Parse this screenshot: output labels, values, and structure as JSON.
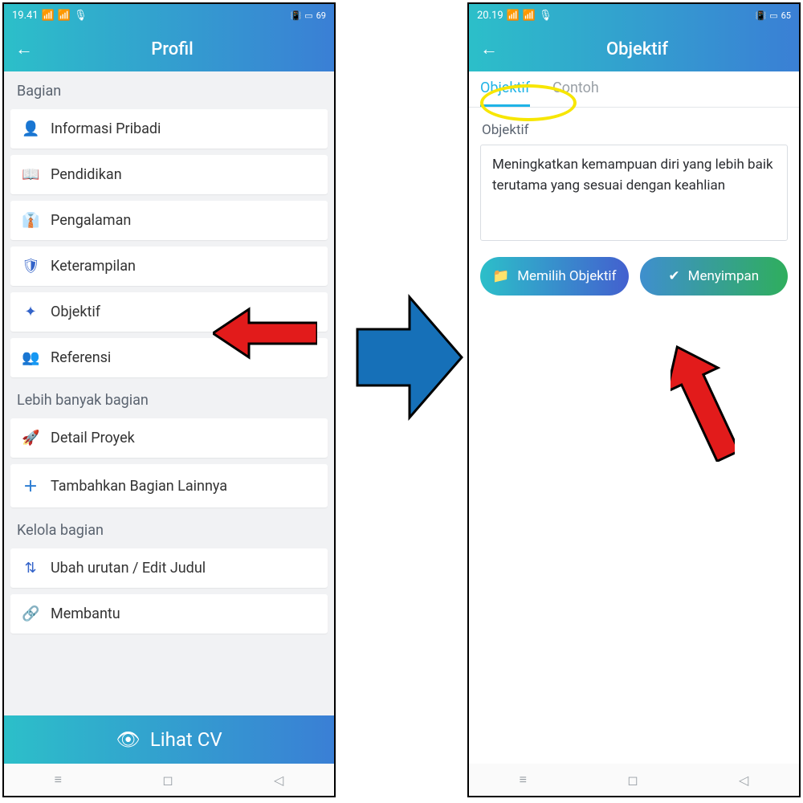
{
  "left": {
    "status": {
      "time": "19.41",
      "battery": "69"
    },
    "header": {
      "title": "Profil"
    },
    "sections": {
      "bagian_label": "Bagian",
      "items": [
        {
          "icon": "user-icon",
          "glyph": "👤",
          "label": "Informasi Pribadi"
        },
        {
          "icon": "education-icon",
          "glyph": "📖",
          "label": "Pendidikan"
        },
        {
          "icon": "experience-icon",
          "glyph": "👔",
          "label": "Pengalaman"
        },
        {
          "icon": "skills-icon",
          "glyph": "🛡",
          "label": "Keterampilan"
        },
        {
          "icon": "objective-icon",
          "glyph": "✦",
          "label": "Objektif"
        },
        {
          "icon": "reference-icon",
          "glyph": "👥",
          "label": "Referensi"
        }
      ],
      "more_label": "Lebih banyak bagian",
      "more_items": [
        {
          "icon": "project-icon",
          "glyph": "🚀",
          "label": "Detail Proyek"
        },
        {
          "icon": "add-icon",
          "glyph": "＋",
          "label": "Tambahkan Bagian Lainnya"
        }
      ],
      "manage_label": "Kelola bagian",
      "manage_items": [
        {
          "icon": "reorder-icon",
          "glyph": "⇅",
          "label": "Ubah urutan / Edit Judul"
        },
        {
          "icon": "help-icon",
          "glyph": "🔗",
          "label": "Membantu"
        }
      ]
    },
    "cta": {
      "icon": "eye-icon",
      "label": "Lihat  CV"
    }
  },
  "right": {
    "status": {
      "time": "20.19",
      "battery": "65"
    },
    "header": {
      "title": "Objektif"
    },
    "tabs": {
      "active": "Objektif",
      "inactive": "Contoh"
    },
    "field_label": "Objektif",
    "field_value": "Meningkatkan kemampuan diri yang lebih baik terutama yang sesuai dengan keahlian",
    "btn_choose": "Memilih Objektif",
    "btn_save": "Menyimpan"
  },
  "annotations": {
    "point_to_objektif": "red-arrow-left",
    "transition_arrow": "blue-big-arrow",
    "point_to_save": "red-arrow-up",
    "highlight_tab": "yellow-oval"
  }
}
